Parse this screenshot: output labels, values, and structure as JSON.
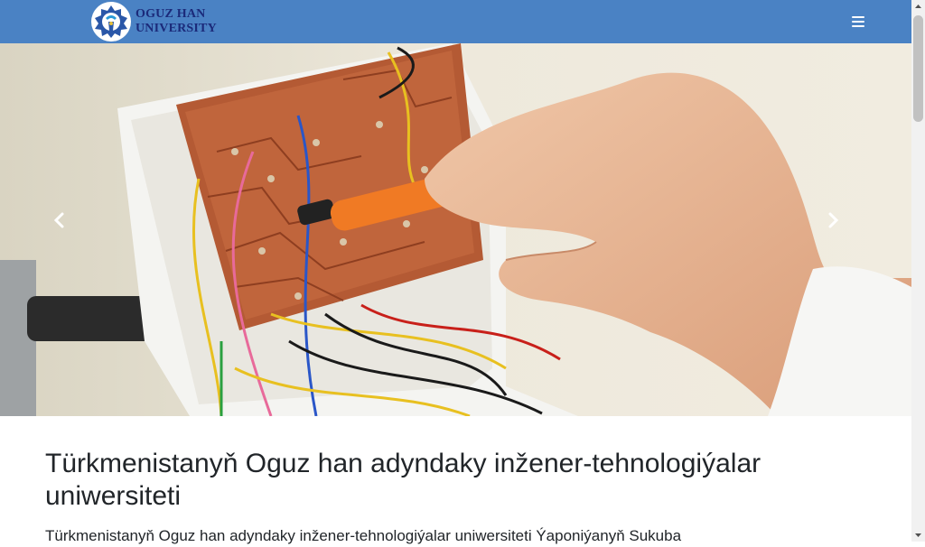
{
  "header": {
    "logo_line1": "OGUZ HAN",
    "logo_line2": "UNIVERSITY",
    "menu_icon": "hamburger-menu-icon",
    "bg_color": "#4a82c4"
  },
  "carousel": {
    "prev_icon": "chevron-left-icon",
    "next_icon": "chevron-right-icon",
    "image": "hand-with-screwdriver-on-circuit-board"
  },
  "main": {
    "title": "Türkmenistanyň Oguz han adyndaky inžener-tehnologiýalar uniwersiteti",
    "lead": "Türkmenistanyň Oguz han adyndaky inžener-tehnologiýalar uniwersiteti Ýaponiýanyň Sukuba"
  }
}
